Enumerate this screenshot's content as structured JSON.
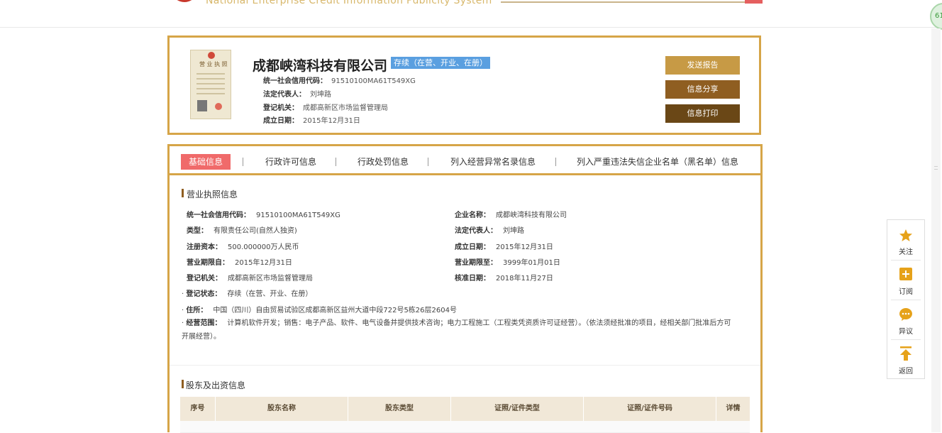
{
  "header": {
    "site_name_en": "National Enterprise Credit Information Publicity System",
    "corner_badge": "61"
  },
  "company": {
    "licence_title": "营 业 执 照",
    "name": "成都峡湾科技有限公司",
    "status": "存续（在营、开业、在册）",
    "rows": [
      {
        "label": "统一社会信用代码：",
        "value": "91510100MA61T549XG"
      },
      {
        "label": "法定代表人：",
        "value": "刘坤路"
      },
      {
        "label": "登记机关：",
        "value": "成都高新区市场监督管理局"
      },
      {
        "label": "成立日期：",
        "value": "2015年12月31日"
      }
    ],
    "buttons": {
      "report": "发送报告",
      "share": "信息分享",
      "print": "信息打印"
    }
  },
  "tabs": [
    {
      "label": "基础信息",
      "active": true
    },
    {
      "label": "行政许可信息"
    },
    {
      "label": "行政处罚信息"
    },
    {
      "label": "列入经营异常名录信息"
    },
    {
      "label": "列入严重违法失信企业名单（黑名单）信息"
    }
  ],
  "licence_section": {
    "title": "营业执照信息",
    "left": [
      {
        "label": "统一社会信用代码：",
        "value": "91510100MA61T549XG"
      },
      {
        "label": "类型：",
        "value": "有限责任公司(自然人独资)"
      },
      {
        "label": "注册资本：",
        "value": "500.000000万人民币"
      },
      {
        "label": "营业期限自：",
        "value": "2015年12月31日"
      },
      {
        "label": "登记机关：",
        "value": "成都高新区市场监督管理局"
      },
      {
        "label": "登记状态：",
        "value": "存续（在营、开业、在册）"
      },
      {
        "label": "住所：",
        "value": "中国（四川）自由贸易试验区成都高新区益州大道中段722号5栋26层2604号"
      }
    ],
    "right": [
      {
        "label": "企业名称：",
        "value": "成都峡湾科技有限公司"
      },
      {
        "label": "法定代表人：",
        "value": "刘坤路"
      },
      {
        "label": "成立日期：",
        "value": "2015年12月31日"
      },
      {
        "label": "营业期限至：",
        "value": "3999年01月01日"
      },
      {
        "label": "核准日期：",
        "value": "2018年11月27日"
      }
    ],
    "scope_label": "经营范围：",
    "scope_line1": "计算机软件开发；销售：电子产品、软件、电气设备并提供技术咨询；电力工程施工（工程类凭资质许可证经营）。（依法须经批准的项目，经相关部门批准后方可",
    "scope_line2": "开展经营）。"
  },
  "shareholder_section": {
    "title": "股东及出资信息",
    "columns": [
      "序号",
      "股东名称",
      "股东类型",
      "证照/证件类型",
      "证照/证件号码",
      "详情"
    ]
  },
  "side_panel": [
    {
      "label": "关注",
      "icon": "star-icon"
    },
    {
      "label": "订阅",
      "icon": "plus-box-icon"
    },
    {
      "label": "异议",
      "icon": "speech-bubble-icon"
    },
    {
      "label": "返回",
      "icon": "arrow-up-icon"
    }
  ],
  "colors": {
    "gold": "#d6a548",
    "brown": "#8f5e21",
    "dark_brown": "#6a4716",
    "tab_active": "#f06a6a",
    "badge_blue": "#5a9fe0",
    "icon_gold": "#e6a21a"
  }
}
